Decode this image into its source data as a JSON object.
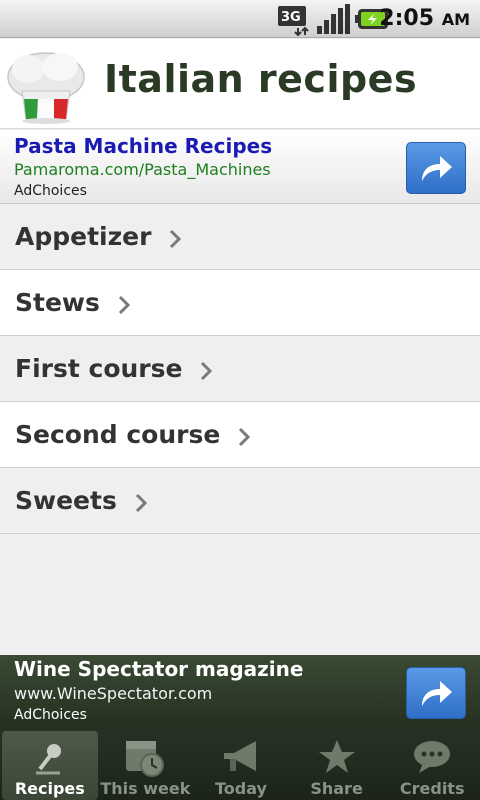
{
  "status_bar": {
    "network": "3G",
    "time": "2:05",
    "ampm": "AM"
  },
  "header": {
    "title": "Italian recipes"
  },
  "ad_top": {
    "title": "Pasta Machine Recipes",
    "url": "Pamaroma.com/Pasta_Machines",
    "choices": "AdChoices"
  },
  "categories": [
    {
      "label": "Appetizer"
    },
    {
      "label": "Stews"
    },
    {
      "label": "First course"
    },
    {
      "label": "Second course"
    },
    {
      "label": "Sweets"
    }
  ],
  "ad_bottom": {
    "title": "Wine Spectator magazine",
    "url": "www.WineSpectator.com",
    "choices": "AdChoices"
  },
  "tabs": [
    {
      "label": "Recipes",
      "icon": "microphone-icon",
      "active": true
    },
    {
      "label": "This week",
      "icon": "calendar-clock-icon",
      "active": false
    },
    {
      "label": "Today",
      "icon": "megaphone-icon",
      "active": false
    },
    {
      "label": "Share",
      "icon": "star-icon",
      "active": false
    },
    {
      "label": "Credits",
      "icon": "speech-bubble-icon",
      "active": false
    }
  ],
  "colors": {
    "ad_link": "#1a1ab4",
    "ad_url": "#1e7f1e",
    "title": "#2b3a24",
    "tab_bar": "#243020",
    "ad_button": "#3a7fd6"
  }
}
